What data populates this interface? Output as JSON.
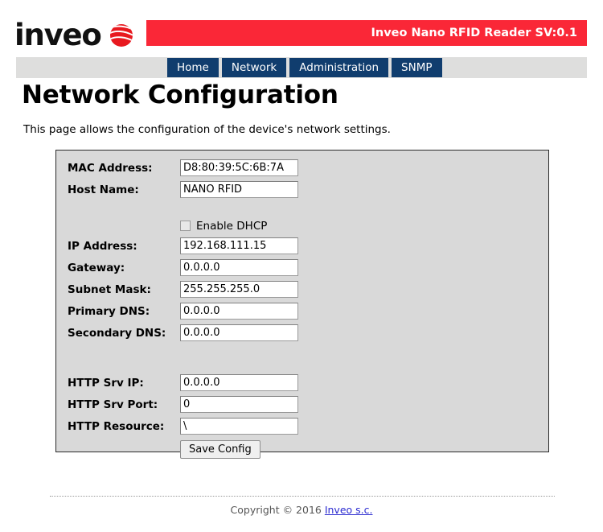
{
  "header": {
    "logo_word": "inveo",
    "logo_mark_name": "inveo-globe-icon",
    "banner_text": "Inveo Nano RFID Reader SV:0.1",
    "banner_color": "#fa2737"
  },
  "nav": {
    "tabs": [
      {
        "label": "Home"
      },
      {
        "label": "Network"
      },
      {
        "label": "Administration"
      },
      {
        "label": "SNMP"
      }
    ],
    "tab_color": "#103d6e",
    "strip_color": "#dededd"
  },
  "page": {
    "title": "Network Configuration",
    "description": "This page allows the configuration of the device's network settings."
  },
  "form": {
    "fields": [
      {
        "label": "MAC Address:",
        "value": "D8:80:39:5C:6B:7A"
      },
      {
        "label": "Host Name:",
        "value": "NANO RFID"
      },
      {
        "label": "IP Address:",
        "value": "192.168.111.15"
      },
      {
        "label": "Gateway:",
        "value": "0.0.0.0"
      },
      {
        "label": "Subnet Mask:",
        "value": "255.255.255.0"
      },
      {
        "label": "Primary DNS:",
        "value": "0.0.0.0"
      },
      {
        "label": "Secondary DNS:",
        "value": "0.0.0.0"
      },
      {
        "label": "HTTP Srv IP:",
        "value": "0.0.0.0"
      },
      {
        "label": "HTTP Srv Port:",
        "value": "0"
      },
      {
        "label": "HTTP Resource:",
        "value": "\\"
      }
    ],
    "dhcp": {
      "label": "Enable DHCP",
      "checked": false
    },
    "save_button": "Save Config"
  },
  "footer": {
    "copyright": "Copyright © 2016 ",
    "link": "Inveo s.c."
  }
}
